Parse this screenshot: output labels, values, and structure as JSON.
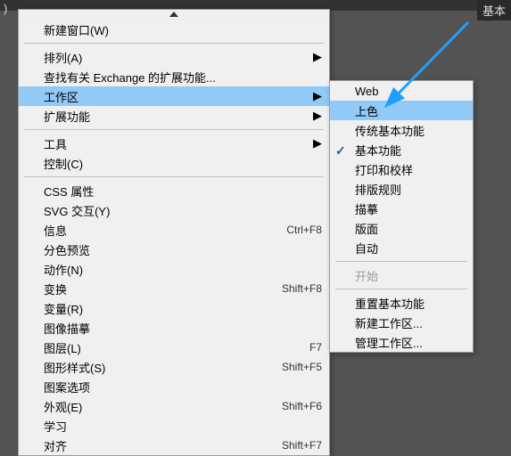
{
  "top": {
    "left_fragment": ")",
    "right_label": "基本"
  },
  "menu": {
    "items": [
      {
        "label": "新建窗口(W)",
        "shortcut": "",
        "submenu": false
      },
      {
        "separator": true
      },
      {
        "label": "排列(A)",
        "shortcut": "",
        "submenu": true
      },
      {
        "label": "查找有关 Exchange 的扩展功能...",
        "shortcut": "",
        "submenu": false
      },
      {
        "label": "工作区",
        "shortcut": "",
        "submenu": true,
        "highlighted": true
      },
      {
        "label": "扩展功能",
        "shortcut": "",
        "submenu": true
      },
      {
        "separator": true
      },
      {
        "label": "工具",
        "shortcut": "",
        "submenu": true
      },
      {
        "label": "控制(C)",
        "shortcut": "",
        "submenu": false
      },
      {
        "separator": true
      },
      {
        "label": "CSS 属性",
        "shortcut": "",
        "submenu": false
      },
      {
        "label": "SVG 交互(Y)",
        "shortcut": "",
        "submenu": false
      },
      {
        "label": "信息",
        "shortcut": "Ctrl+F8",
        "submenu": false
      },
      {
        "label": "分色预览",
        "shortcut": "",
        "submenu": false
      },
      {
        "label": "动作(N)",
        "shortcut": "",
        "submenu": false
      },
      {
        "label": "变换",
        "shortcut": "Shift+F8",
        "submenu": false
      },
      {
        "label": "变量(R)",
        "shortcut": "",
        "submenu": false
      },
      {
        "label": "图像描摹",
        "shortcut": "",
        "submenu": false
      },
      {
        "label": "图层(L)",
        "shortcut": "F7",
        "submenu": false
      },
      {
        "label": "图形样式(S)",
        "shortcut": "Shift+F5",
        "submenu": false
      },
      {
        "label": "图案选项",
        "shortcut": "",
        "submenu": false
      },
      {
        "label": "外观(E)",
        "shortcut": "Shift+F6",
        "submenu": false
      },
      {
        "label": "学习",
        "shortcut": "",
        "submenu": false
      },
      {
        "label": "对齐",
        "shortcut": "Shift+F7",
        "submenu": false
      }
    ]
  },
  "submenu": {
    "items": [
      {
        "label": "Web"
      },
      {
        "label": "上色",
        "highlighted": true
      },
      {
        "label": "传统基本功能"
      },
      {
        "label": "基本功能",
        "checked": true
      },
      {
        "label": "打印和校样"
      },
      {
        "label": "排版规则"
      },
      {
        "label": "描摹"
      },
      {
        "label": "版面"
      },
      {
        "label": "自动"
      },
      {
        "separator": true
      },
      {
        "label": "开始",
        "disabled": true
      },
      {
        "separator": true
      },
      {
        "label": "重置基本功能"
      },
      {
        "label": "新建工作区..."
      },
      {
        "label": "管理工作区..."
      }
    ]
  }
}
